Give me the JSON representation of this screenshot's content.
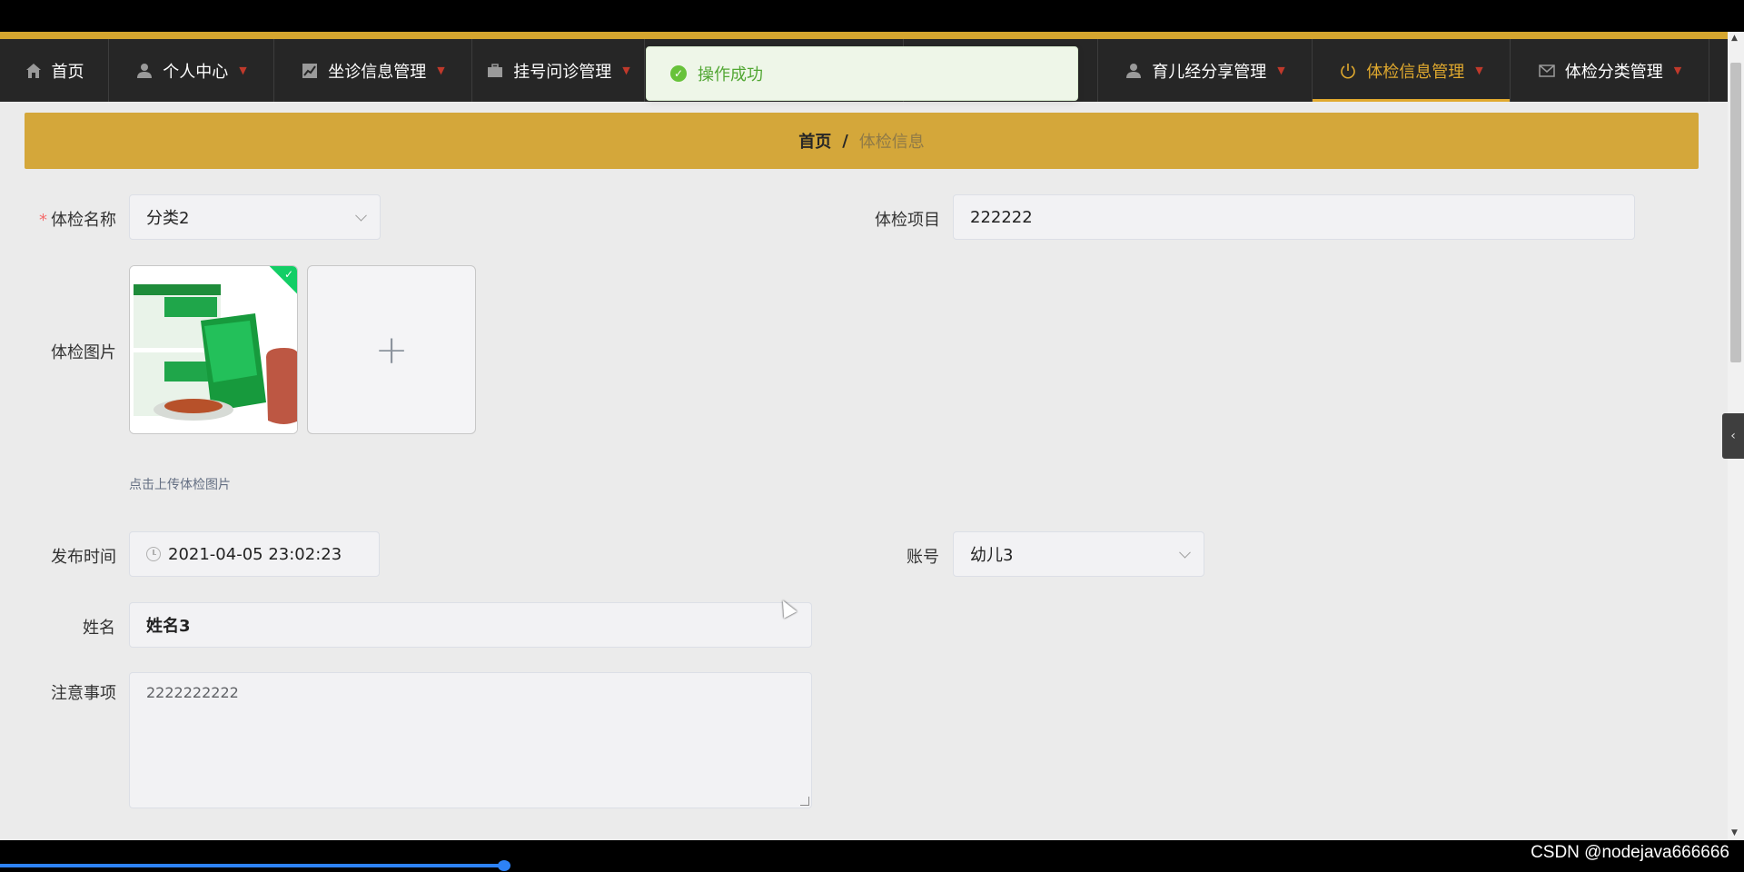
{
  "nav": {
    "items": [
      {
        "label": "首页",
        "icon": "home-icon",
        "caret": false,
        "active": false
      },
      {
        "label": "个人中心",
        "icon": "user-icon",
        "caret": true,
        "active": false
      },
      {
        "label": "坐诊信息管理",
        "icon": "chart-icon",
        "caret": true,
        "active": false
      },
      {
        "label": "挂号问诊管理",
        "icon": "briefcase-icon",
        "caret": true,
        "active": false
      },
      {
        "label": "",
        "icon": "",
        "caret": false,
        "active": false
      },
      {
        "label": "",
        "icon": "",
        "caret": false,
        "active": false
      },
      {
        "label": "育儿经分享管理",
        "icon": "user-icon",
        "caret": true,
        "active": false
      },
      {
        "label": "体检信息管理",
        "icon": "power-icon",
        "caret": true,
        "active": true
      },
      {
        "label": "体检分类管理",
        "icon": "mail-icon",
        "caret": true,
        "active": false
      }
    ]
  },
  "toast": {
    "message": "操作成功"
  },
  "breadcrumb": {
    "home": "首页",
    "separator": "/",
    "current": "体检信息"
  },
  "form": {
    "name_label": "体检名称",
    "name_value": "分类2",
    "project_label": "体检项目",
    "project_value": "222222",
    "image_label": "体检图片",
    "upload_hint": "点击上传体检图片",
    "upload_plus": "+",
    "publish_label": "发布时间",
    "publish_value": "2021-04-05 23:02:23",
    "account_label": "账号",
    "account_value": "幼儿3",
    "fullname_label": "姓名",
    "fullname_value": "姓名3",
    "notes_label": "注意事项",
    "notes_value": "2222222222"
  },
  "colors": {
    "accent": "#d4a73a",
    "nav_bg": "#262626",
    "active": "#e0a92e",
    "success": "#67c23a"
  },
  "watermark": "CSDN @nodejava666666"
}
